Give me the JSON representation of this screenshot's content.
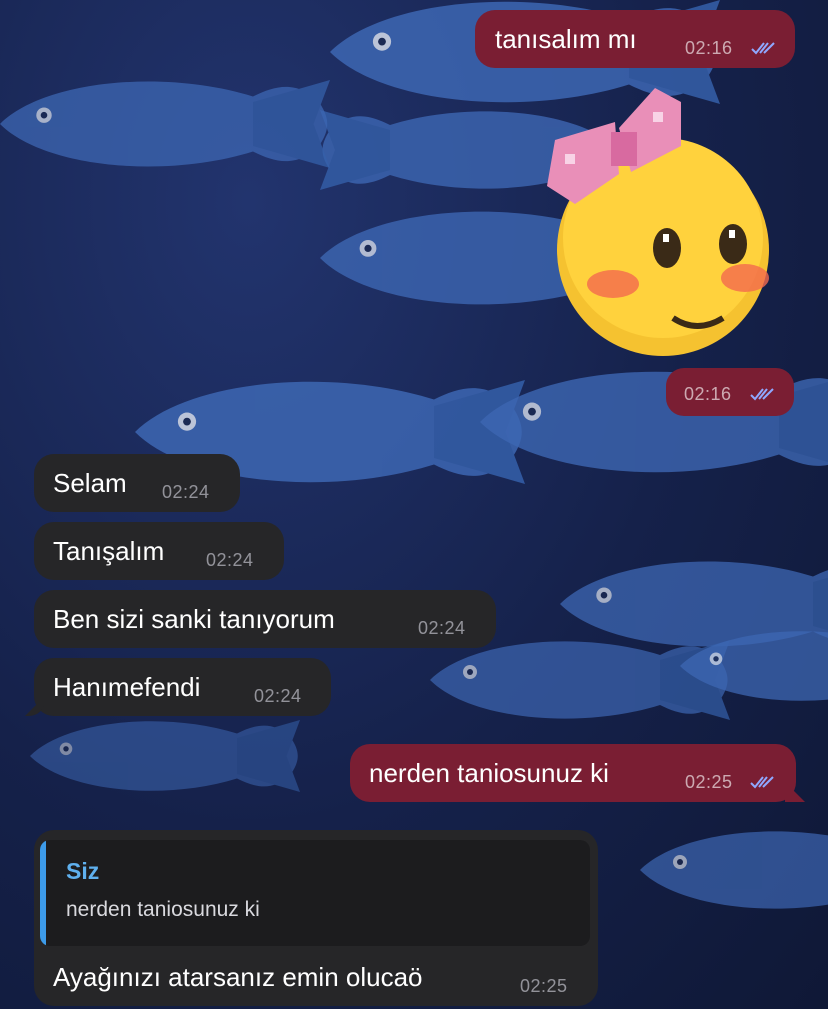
{
  "chat": {
    "messages": [
      {
        "direction": "outgoing",
        "text": "tanısalım mı",
        "time": "02:16",
        "status": "read-ticks-icon"
      },
      {
        "direction": "outgoing",
        "type": "sticker",
        "sticker": "pixel-blushing-face-with-pink-bow",
        "time": "02:16",
        "status": "read-ticks-icon"
      },
      {
        "direction": "incoming",
        "text": "Selam",
        "time": "02:24"
      },
      {
        "direction": "incoming",
        "text": "Tanışalım",
        "time": "02:24"
      },
      {
        "direction": "incoming",
        "text": "Ben sizi sanki tanıyorum",
        "time": "02:24"
      },
      {
        "direction": "incoming",
        "text": "Hanımefendi",
        "time": "02:24"
      },
      {
        "direction": "outgoing",
        "text": "nerden taniosunuz ki",
        "time": "02:25",
        "status": "read-ticks-icon"
      },
      {
        "direction": "incoming",
        "text": "Ayağınızı atarsanız emin olucaö",
        "time": "02:25",
        "reply_to": {
          "author": "Siz",
          "text": "nerden taniosunuz ki"
        }
      }
    ]
  },
  "colors": {
    "outgoing_bubble": "#7a1e33",
    "incoming_bubble": "#262628",
    "reply_accent": "#3d9be9",
    "ticks": "#8fa8ff"
  }
}
